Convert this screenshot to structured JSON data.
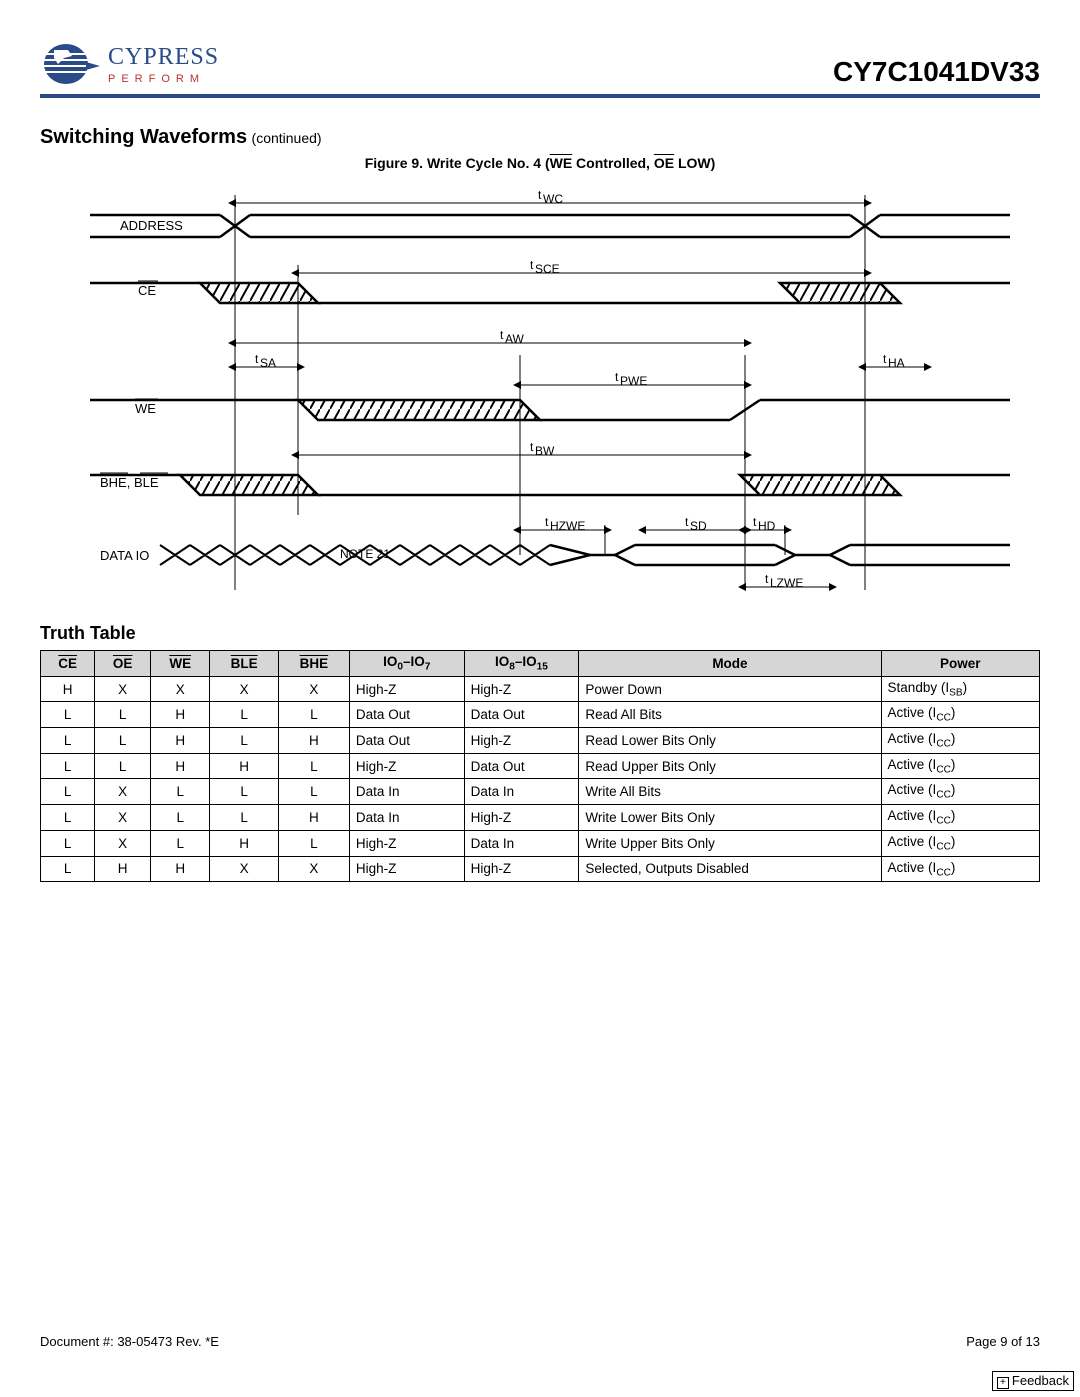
{
  "header": {
    "company": "CYPRESS",
    "tagline": "PERFORM",
    "part_number": "CY7C1041DV33"
  },
  "section": {
    "title": "Switching Waveforms",
    "continued": "(continued)"
  },
  "figure": {
    "prefix": "Figure 9.  Write Cycle No. 4 (",
    "we": "WE",
    "mid": " Controlled, ",
    "oe": "OE",
    "suffix": " LOW)"
  },
  "timing": {
    "signals": {
      "address": "ADDRESS",
      "ce": "CE",
      "we": "WE",
      "bhe_ble_a": "BHE",
      "bhe_ble_sep": ", ",
      "bhe_ble_b": "BLE",
      "data_io": "DATA IO"
    },
    "labels": {
      "twc": "WC",
      "tsce": "SCE",
      "taw": "AW",
      "tsa": "SA",
      "tha": "HA",
      "tpwe": "PWE",
      "tbw": "BW",
      "thzwe": "HZWE",
      "tsd": "SD",
      "thd": "HD",
      "tlzwe": "LZWE"
    },
    "note21": "NOTE 21"
  },
  "truth_table": {
    "title": "Truth Table",
    "headers": {
      "ce": "CE",
      "oe": "OE",
      "we": "WE",
      "ble": "BLE",
      "bhe": "BHE",
      "io07_a": "IO",
      "io07_b": "0",
      "io07_c": "–IO",
      "io07_d": "7",
      "io815_a": "IO",
      "io815_b": "8",
      "io815_c": "–IO",
      "io815_d": "15",
      "mode": "Mode",
      "power": "Power"
    },
    "rows": [
      {
        "ce": "H",
        "oe": "X",
        "we": "X",
        "ble": "X",
        "bhe": "X",
        "io07": "High-Z",
        "io815": "High-Z",
        "mode": "Power Down",
        "power_a": "Standby (I",
        "power_sub": "SB",
        "power_b": ")"
      },
      {
        "ce": "L",
        "oe": "L",
        "we": "H",
        "ble": "L",
        "bhe": "L",
        "io07": "Data Out",
        "io815": "Data Out",
        "mode": "Read All Bits",
        "power_a": "Active (I",
        "power_sub": "CC",
        "power_b": ")"
      },
      {
        "ce": "L",
        "oe": "L",
        "we": "H",
        "ble": "L",
        "bhe": "H",
        "io07": "Data Out",
        "io815": "High-Z",
        "mode": "Read Lower Bits Only",
        "power_a": "Active (I",
        "power_sub": "CC",
        "power_b": ")"
      },
      {
        "ce": "L",
        "oe": "L",
        "we": "H",
        "ble": "H",
        "bhe": "L",
        "io07": "High-Z",
        "io815": "Data Out",
        "mode": "Read Upper Bits Only",
        "power_a": "Active (I",
        "power_sub": "CC",
        "power_b": ")"
      },
      {
        "ce": "L",
        "oe": "X",
        "we": "L",
        "ble": "L",
        "bhe": "L",
        "io07": "Data In",
        "io815": "Data In",
        "mode": "Write All Bits",
        "power_a": "Active (I",
        "power_sub": "CC",
        "power_b": ")"
      },
      {
        "ce": "L",
        "oe": "X",
        "we": "L",
        "ble": "L",
        "bhe": "H",
        "io07": "Data In",
        "io815": "High-Z",
        "mode": "Write Lower Bits Only",
        "power_a": "Active (I",
        "power_sub": "CC",
        "power_b": ")"
      },
      {
        "ce": "L",
        "oe": "X",
        "we": "L",
        "ble": "H",
        "bhe": "L",
        "io07": "High-Z",
        "io815": "Data In",
        "mode": "Write Upper Bits Only",
        "power_a": "Active (I",
        "power_sub": "CC",
        "power_b": ")"
      },
      {
        "ce": "L",
        "oe": "H",
        "we": "H",
        "ble": "X",
        "bhe": "X",
        "io07": "High-Z",
        "io815": "High-Z",
        "mode": "Selected, Outputs Disabled",
        "power_a": "Active (I",
        "power_sub": "CC",
        "power_b": ")"
      }
    ]
  },
  "footer": {
    "doc": "Document #: 38-05473  Rev. *E",
    "page": "Page 9 of 13"
  },
  "feedback": {
    "plus": "+",
    "label": "Feedback"
  }
}
